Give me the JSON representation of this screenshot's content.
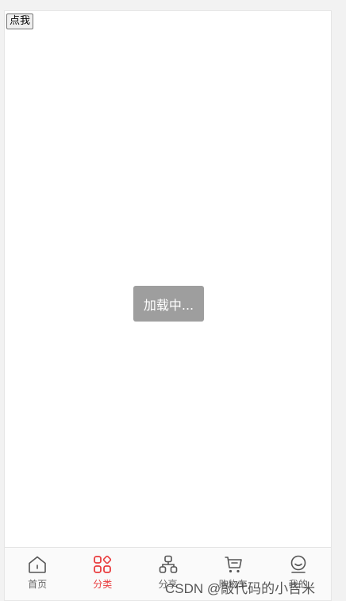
{
  "button": {
    "label": "点我"
  },
  "loading": {
    "text": "加载中..."
  },
  "tabbar": {
    "items": [
      {
        "label": "首页",
        "icon": "home-icon",
        "active": false
      },
      {
        "label": "分类",
        "icon": "category-icon",
        "active": true
      },
      {
        "label": "分享",
        "icon": "share-icon",
        "active": false
      },
      {
        "label": "购物车",
        "icon": "cart-icon",
        "active": false
      },
      {
        "label": "我的",
        "icon": "profile-icon",
        "active": false
      }
    ]
  },
  "watermark": {
    "text": "CSDN @敲代码的小吉米"
  },
  "colors": {
    "accent": "#e93b3d",
    "inactive": "#555555"
  }
}
